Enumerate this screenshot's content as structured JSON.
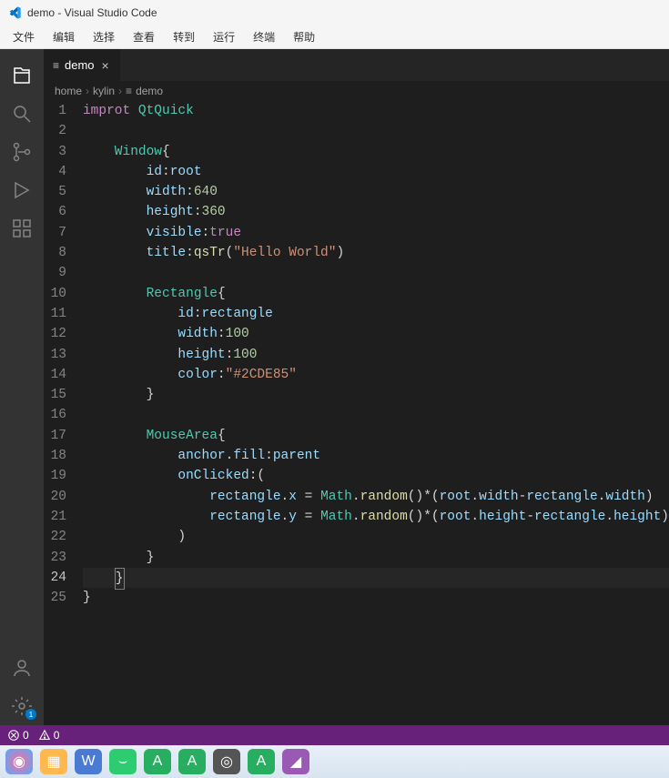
{
  "window": {
    "title": "demo - Visual Studio Code"
  },
  "menu": {
    "file": "文件",
    "edit": "编辑",
    "select": "选择",
    "view": "查看",
    "go": "转到",
    "run": "运行",
    "terminal": "终端",
    "help": "帮助"
  },
  "tab": {
    "label": "demo",
    "modified": false
  },
  "breadcrumb": {
    "parts": [
      "home",
      "kylin",
      "demo"
    ],
    "fileIcon": "≡"
  },
  "code": {
    "lines": [
      {
        "n": 1,
        "text": "improt QtQuick"
      },
      {
        "n": 2,
        "text": ""
      },
      {
        "n": 3,
        "text": "    Window{"
      },
      {
        "n": 4,
        "text": "        id:root"
      },
      {
        "n": 5,
        "text": "        width:640"
      },
      {
        "n": 6,
        "text": "        height:360"
      },
      {
        "n": 7,
        "text": "        visible:true"
      },
      {
        "n": 8,
        "text": "        title:qsTr(\"Hello World\")"
      },
      {
        "n": 9,
        "text": ""
      },
      {
        "n": 10,
        "text": "        Rectangle{"
      },
      {
        "n": 11,
        "text": "            id:rectangle"
      },
      {
        "n": 12,
        "text": "            width:100"
      },
      {
        "n": 13,
        "text": "            height:100"
      },
      {
        "n": 14,
        "text": "            color:\"#2CDE85\""
      },
      {
        "n": 15,
        "text": "        }"
      },
      {
        "n": 16,
        "text": ""
      },
      {
        "n": 17,
        "text": "        MouseArea{"
      },
      {
        "n": 18,
        "text": "            anchor.fill:parent"
      },
      {
        "n": 19,
        "text": "            onClicked:("
      },
      {
        "n": 20,
        "text": "                rectangle.x = Math.random()*(root.width-rectangle.width)"
      },
      {
        "n": 21,
        "text": "                rectangle.y = Math.random()*(root.height-rectangle.height)"
      },
      {
        "n": 22,
        "text": "            )"
      },
      {
        "n": 23,
        "text": "        }"
      },
      {
        "n": 24,
        "text": "    }"
      },
      {
        "n": 25,
        "text": "}"
      }
    ],
    "currentLine": 24
  },
  "status": {
    "errors": "0",
    "warnings": "0"
  },
  "colors": {
    "accent": "#007acc",
    "statusBg": "#68217a",
    "rectColor": "#2CDE85"
  },
  "settingsBadge": "1"
}
